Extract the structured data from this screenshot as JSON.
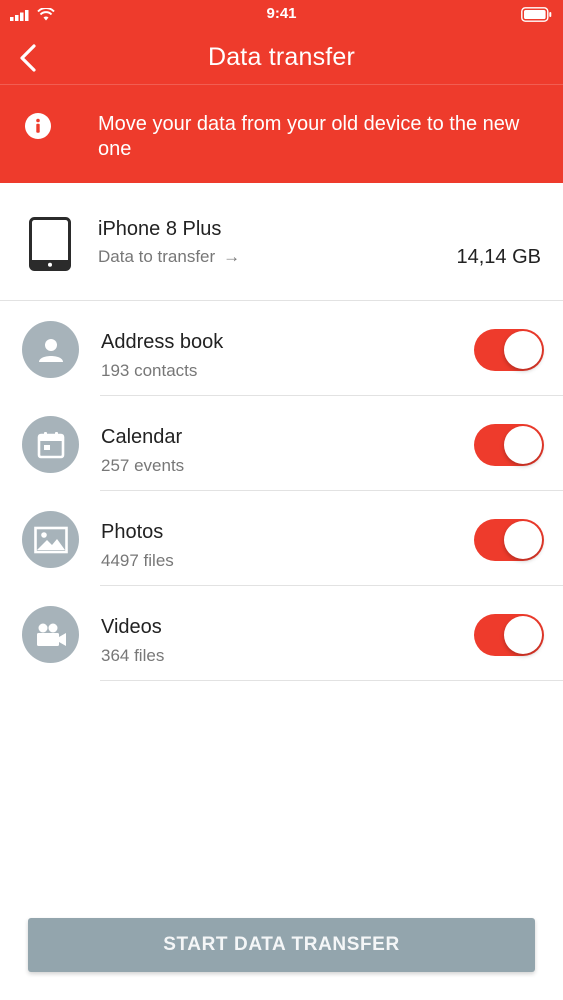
{
  "status": {
    "time": "9:41",
    "icons": [
      "signal-icon",
      "wifi-icon",
      "battery-icon"
    ]
  },
  "nav": {
    "title": "Data transfer",
    "back_icon": "chevron-left-icon"
  },
  "banner": {
    "icon": "info-icon",
    "text": "Move your data from your old device to the new one"
  },
  "device": {
    "icon": "tablet-icon",
    "name": "iPhone 8 Plus",
    "subtitle": "Data to transfer",
    "arrow": "→",
    "size": "14,14 GB"
  },
  "items": [
    {
      "icon": "contact-icon",
      "title": "Address book",
      "subtitle": "193 contacts",
      "enabled": true
    },
    {
      "icon": "calendar-icon",
      "title": "Calendar",
      "subtitle": "257 events",
      "enabled": true
    },
    {
      "icon": "photo-icon",
      "title": "Photos",
      "subtitle": "4497 files",
      "enabled": true
    },
    {
      "icon": "video-camera-icon",
      "title": "Videos",
      "subtitle": "364 files",
      "enabled": true
    }
  ],
  "start_button": {
    "label": "START DATA TRANSFER"
  },
  "colors": {
    "accent": "#ee3b2c",
    "icon_circle": "#a7b3ba",
    "button_disabled": "#93a5ad"
  }
}
